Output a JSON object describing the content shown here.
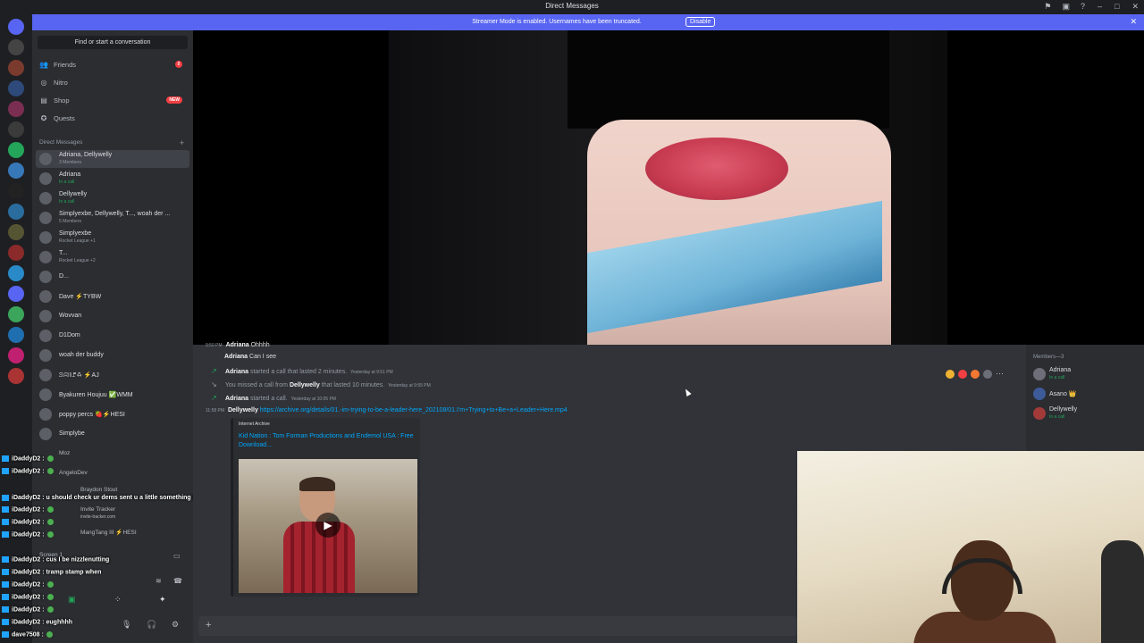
{
  "window": {
    "title": "Direct Messages"
  },
  "banner": {
    "message": "Streamer Mode is enabled. Usernames have been truncated.",
    "button": "Disable"
  },
  "sidebar": {
    "search_placeholder": "Find or start a conversation",
    "nav": [
      {
        "label": "Friends",
        "icon": "friends-icon",
        "badge": "8"
      },
      {
        "label": "Nitro",
        "icon": "nitro-icon"
      },
      {
        "label": "Shop",
        "icon": "shop-icon",
        "badge": "NEW"
      },
      {
        "label": "Quests",
        "icon": "quests-icon"
      }
    ],
    "dm_header": "Direct Messages",
    "dms": [
      {
        "name": "Adriana, Dellywelly",
        "sub": "3 Members"
      },
      {
        "name": "Adriana",
        "sub": "In a call"
      },
      {
        "name": "Dellywelly",
        "sub": "In a call"
      },
      {
        "name": "Simplyexbe, Dellywelly, T..., woah der ...",
        "sub": "5 Members"
      },
      {
        "name": "Simplyexbe",
        "sub": "Rocket League +1"
      },
      {
        "name": "T...",
        "sub": "Rocket League +2"
      },
      {
        "name": "D...",
        "sub": ""
      },
      {
        "name": "Dave ⚡TYBW",
        "sub": ""
      },
      {
        "name": "Wovvan",
        "sub": ""
      },
      {
        "name": "D1Dom",
        "sub": ""
      },
      {
        "name": "woah der buddy",
        "sub": ""
      },
      {
        "name": "ꕶꕸꔖꘝꗇ ⚡AJ",
        "sub": ""
      },
      {
        "name": "Byakuren Houjuu ✅WMM",
        "sub": ""
      },
      {
        "name": "poppy percs 🍓⚡HESI",
        "sub": ""
      },
      {
        "name": "Simplybe",
        "sub": ""
      }
    ],
    "peek": [
      "Moz",
      "AngeloDev",
      "Braydon Stout",
      "Invite Tracker",
      "invite-tracker.com",
      "MangTang III ⚡HESI",
      "Screen 1"
    ]
  },
  "twitch_chat": [
    {
      "user": "iDaddyD2 :",
      "text": ""
    },
    {
      "user": "iDaddyD2 :",
      "text": ""
    },
    {
      "user": "iDaddyD2 :",
      "text": "u should check ur dems sent u a little something 😏😏"
    },
    {
      "user": "iDaddyD2 :",
      "text": ""
    },
    {
      "user": "iDaddyD2 :",
      "text": ""
    },
    {
      "user": "iDaddyD2 :",
      "text": ""
    },
    {
      "user": "iDaddyD2 :",
      "text": "cus I be nizzlenutting"
    },
    {
      "user": "iDaddyD2 :",
      "text": "tramp stamp when"
    },
    {
      "user": "iDaddyD2 :",
      "text": ""
    },
    {
      "user": "iDaddyD2 :",
      "text": ""
    },
    {
      "user": "iDaddyD2 :",
      "text": ""
    },
    {
      "user": "iDaddyD2 :",
      "text": "eughhhh"
    },
    {
      "user": "dave7508 :",
      "text": ""
    }
  ],
  "messages": [
    {
      "time": "9:50 PM",
      "author": "Adriana",
      "text": "Ohhhh",
      "type": "message"
    },
    {
      "author": "Adriana",
      "text": "Can I see",
      "type": "message"
    },
    {
      "author": "Adriana",
      "text": "started a call that lasted 2 minutes.",
      "ts": "Yesterday at 9:51 PM",
      "type": "call"
    },
    {
      "prefix": "You missed a call from",
      "author": "Dellywelly",
      "text": "that lasted 10 minutes.",
      "ts": "Yesterday at 9:55 PM",
      "type": "missed"
    },
    {
      "author": "Adriana",
      "text": "started a call.",
      "ts": "Yesterday at 10:05 PM",
      "type": "call"
    },
    {
      "time": "11:58 PM",
      "author": "Dellywelly",
      "link": "https://archive.org/details/01.-im-trying-to-be-a-leader-here_202108/01.I'm+Trying+to+Be+a+Leader+Here.mp4",
      "type": "link"
    }
  ],
  "embed": {
    "provider": "Internet Archive",
    "title": "Kid Nation : Tom Forman Productions and Endemol USA : Free Download..."
  },
  "members": {
    "header": "Members—3",
    "list": [
      {
        "name": "Adriana",
        "sub": "In a call"
      },
      {
        "name": "Asano 👑",
        "sub": ""
      },
      {
        "name": "Dellywelly",
        "sub": "In a call"
      }
    ]
  },
  "colors": {
    "blurple": "#5865f2",
    "green": "#23a55a",
    "red": "#f23f43",
    "link": "#00a8fc"
  }
}
